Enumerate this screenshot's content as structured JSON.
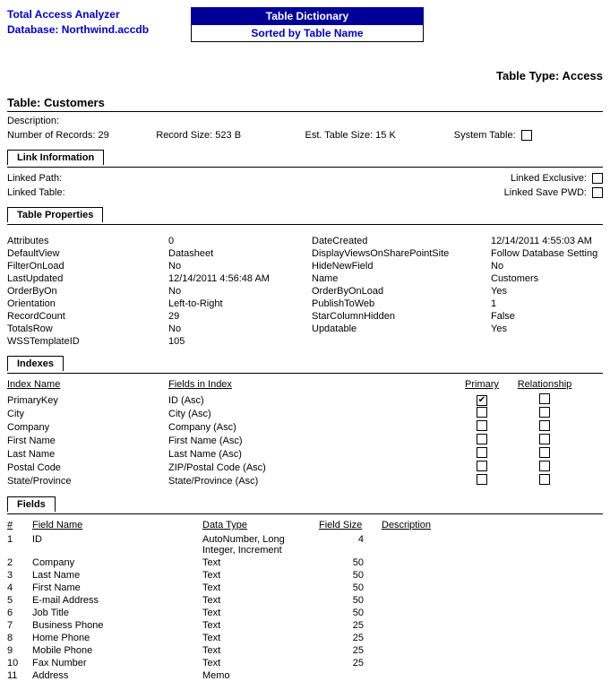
{
  "header": {
    "app": "Total Access Analyzer",
    "db_label": "Database: ",
    "db_value": "Northwind.accdb",
    "box_title": "Table Dictionary",
    "box_sub": "Sorted by Table Name"
  },
  "table": {
    "title_label": "Table:  ",
    "title_value": "Customers",
    "type_label": "Table Type: ",
    "type_value": "Access",
    "description_label": "Description:",
    "records_label": "Number of Records: ",
    "records_value": "29",
    "record_size_label": "Record Size: ",
    "record_size_value": "523 B",
    "est_size_label": "Est. Table Size: ",
    "est_size_value": "15 K",
    "system_table_label": "System Table:"
  },
  "link": {
    "section": "Link Information",
    "path_label": "Linked Path:",
    "table_label": "Linked Table:",
    "exclusive_label": "Linked Exclusive:",
    "save_pwd_label": "Linked Save PWD:"
  },
  "props": {
    "section": "Table Properties",
    "left": [
      {
        "k": "Attributes",
        "v": "0"
      },
      {
        "k": "DefaultView",
        "v": "Datasheet"
      },
      {
        "k": "FilterOnLoad",
        "v": "No"
      },
      {
        "k": "LastUpdated",
        "v": "12/14/2011 4:56:48 AM"
      },
      {
        "k": "OrderByOn",
        "v": "No"
      },
      {
        "k": "Orientation",
        "v": "Left-to-Right"
      },
      {
        "k": "RecordCount",
        "v": "29"
      },
      {
        "k": "TotalsRow",
        "v": "No"
      },
      {
        "k": "WSSTemplateID",
        "v": "105"
      }
    ],
    "right": [
      {
        "k": "DateCreated",
        "v": "12/14/2011 4:55:03 AM"
      },
      {
        "k": "DisplayViewsOnSharePointSite",
        "v": "Follow Database Setting"
      },
      {
        "k": "HideNewField",
        "v": "No"
      },
      {
        "k": "Name",
        "v": "Customers"
      },
      {
        "k": "OrderByOnLoad",
        "v": "Yes"
      },
      {
        "k": "PublishToWeb",
        "v": "1"
      },
      {
        "k": "StarColumnHidden",
        "v": "False"
      },
      {
        "k": "Updatable",
        "v": "Yes"
      }
    ]
  },
  "indexes": {
    "section": "Indexes",
    "h_name": "Index Name",
    "h_fields": "Fields in Index",
    "h_primary": "Primary",
    "h_rel": "Relationship",
    "rows": [
      {
        "name": "PrimaryKey",
        "fields": "ID (Asc)",
        "primary": true,
        "rel": false
      },
      {
        "name": "City",
        "fields": "City (Asc)",
        "primary": false,
        "rel": false
      },
      {
        "name": "Company",
        "fields": "Company (Asc)",
        "primary": false,
        "rel": false
      },
      {
        "name": "First Name",
        "fields": "First Name (Asc)",
        "primary": false,
        "rel": false
      },
      {
        "name": "Last Name",
        "fields": "Last Name (Asc)",
        "primary": false,
        "rel": false
      },
      {
        "name": "Postal Code",
        "fields": "ZIP/Postal Code (Asc)",
        "primary": false,
        "rel": false
      },
      {
        "name": "State/Province",
        "fields": "State/Province (Asc)",
        "primary": false,
        "rel": false
      }
    ]
  },
  "fields": {
    "section": "Fields",
    "h_num": "#",
    "h_name": "Field Name",
    "h_type": "Data Type",
    "h_size": "Field Size",
    "h_desc": "Description",
    "rows": [
      {
        "n": "1",
        "name": "ID",
        "type": "AutoNumber, Long Integer, Increment",
        "size": "4",
        "desc": ""
      },
      {
        "n": "2",
        "name": "Company",
        "type": "Text",
        "size": "50",
        "desc": ""
      },
      {
        "n": "3",
        "name": "Last Name",
        "type": "Text",
        "size": "50",
        "desc": ""
      },
      {
        "n": "4",
        "name": "First Name",
        "type": "Text",
        "size": "50",
        "desc": ""
      },
      {
        "n": "5",
        "name": "E-mail Address",
        "type": "Text",
        "size": "50",
        "desc": ""
      },
      {
        "n": "6",
        "name": "Job Title",
        "type": "Text",
        "size": "50",
        "desc": ""
      },
      {
        "n": "7",
        "name": "Business Phone",
        "type": "Text",
        "size": "25",
        "desc": ""
      },
      {
        "n": "8",
        "name": "Home Phone",
        "type": "Text",
        "size": "25",
        "desc": ""
      },
      {
        "n": "9",
        "name": "Mobile Phone",
        "type": "Text",
        "size": "25",
        "desc": ""
      },
      {
        "n": "10",
        "name": "Fax Number",
        "type": "Text",
        "size": "25",
        "desc": ""
      },
      {
        "n": "11",
        "name": "Address",
        "type": "Memo",
        "size": "",
        "desc": ""
      }
    ]
  }
}
